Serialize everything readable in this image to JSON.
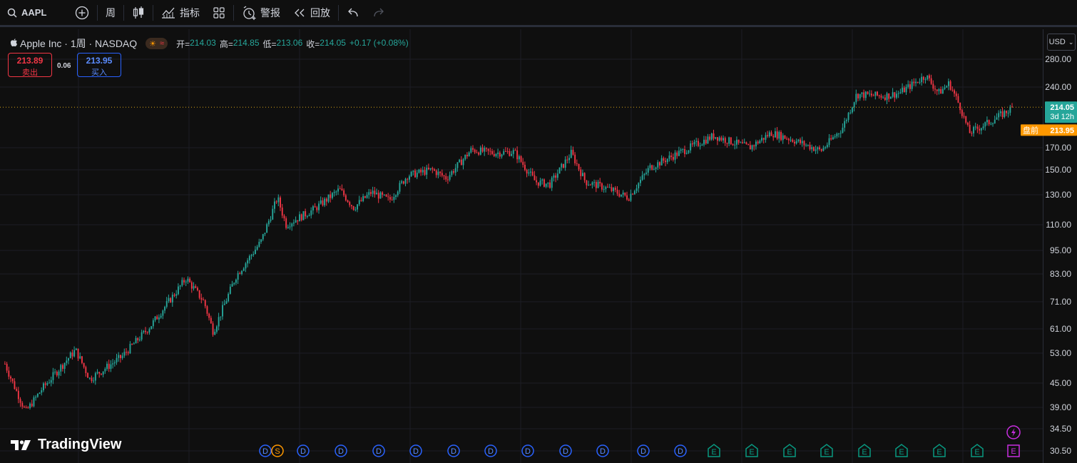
{
  "toolbar": {
    "symbol": "AAPL",
    "interval": "周",
    "indicators": "指标",
    "alerts": "警报",
    "replay": "回放"
  },
  "legend": {
    "title": "Apple Inc · 1周 · NASDAQ",
    "open_label": "开=",
    "open": "214.03",
    "high_label": "高=",
    "high": "214.85",
    "low_label": "低=",
    "low": "213.06",
    "close_label": "收=",
    "close": "214.05",
    "change": "+0.17 (+0.08%)"
  },
  "quote": {
    "sell_price": "213.89",
    "sell_label": "卖出",
    "spread": "0.06",
    "buy_price": "213.95",
    "buy_label": "买入"
  },
  "currency": "USD",
  "price_axis": {
    "ticks": [
      "280.00",
      "240.00",
      "170.00",
      "150.00",
      "130.00",
      "110.00",
      "95.00",
      "83.00",
      "71.00",
      "61.00",
      "53.00",
      "45.00",
      "39.00",
      "34.50",
      "30.50"
    ],
    "last_price": "214.05",
    "countdown": "3d 12h",
    "premarket_label": "盘前",
    "premarket_price": "213.95"
  },
  "event_markers": [
    {
      "type": "D"
    },
    {
      "type": "S"
    },
    {
      "type": "D"
    },
    {
      "type": "D"
    },
    {
      "type": "D"
    },
    {
      "type": "D"
    },
    {
      "type": "D"
    },
    {
      "type": "D"
    },
    {
      "type": "D"
    },
    {
      "type": "D"
    },
    {
      "type": "D"
    },
    {
      "type": "D"
    },
    {
      "type": "D"
    },
    {
      "type": "E"
    },
    {
      "type": "E"
    },
    {
      "type": "E"
    },
    {
      "type": "E"
    },
    {
      "type": "E"
    },
    {
      "type": "E"
    },
    {
      "type": "E"
    },
    {
      "type": "E"
    },
    {
      "type": "E-upcoming"
    }
  ],
  "colors": {
    "up": "#26a69a",
    "down": "#f23645",
    "dividend": "#2962ff",
    "split": "#ff9800",
    "earnings": "#089981",
    "upcoming": "#c82ee0",
    "premarket": "#ff9800"
  },
  "brand": "TradingView"
}
